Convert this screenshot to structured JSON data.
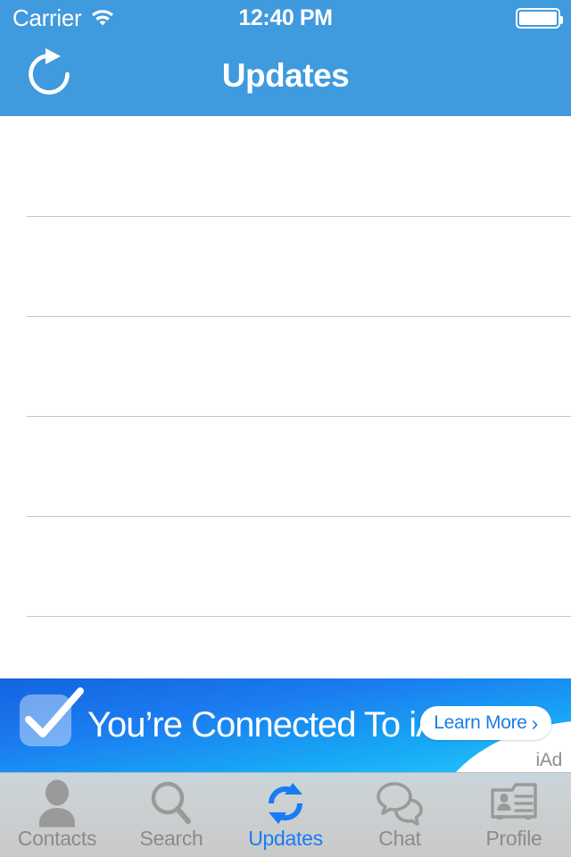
{
  "status_bar": {
    "carrier": "Carrier",
    "wifi_icon": "wifi-icon",
    "time": "12:40 PM",
    "battery_icon": "battery-icon",
    "battery_level_percent": 100
  },
  "nav_bar": {
    "title": "Updates",
    "refresh_icon": "refresh-icon"
  },
  "table": {
    "row_count": 5,
    "rows": [
      {
        "text": ""
      },
      {
        "text": ""
      },
      {
        "text": ""
      },
      {
        "text": ""
      },
      {
        "text": ""
      }
    ]
  },
  "ad_banner": {
    "checkmark_icon": "checkmark-icon",
    "headline": "You’re Connected To iAd",
    "cta_label": "Learn More",
    "cta_chevron": "›",
    "attribution": "iAd"
  },
  "tab_bar": {
    "active_index": 2,
    "items": [
      {
        "label": "Contacts",
        "icon": "person-icon"
      },
      {
        "label": "Search",
        "icon": "magnifier-icon"
      },
      {
        "label": "Updates",
        "icon": "sync-arrows-icon"
      },
      {
        "label": "Chat",
        "icon": "speech-bubbles-icon"
      },
      {
        "label": "Profile",
        "icon": "contact-card-icon"
      }
    ]
  },
  "colors": {
    "nav_blue": "#3f9ade",
    "tab_active_blue": "#1a7cf5",
    "tab_inactive_gray": "#8b8b8b",
    "separator_gray": "#c8c7cc",
    "ad_blue_dark": "#1464e0",
    "ad_blue_light": "#26c6fb"
  }
}
